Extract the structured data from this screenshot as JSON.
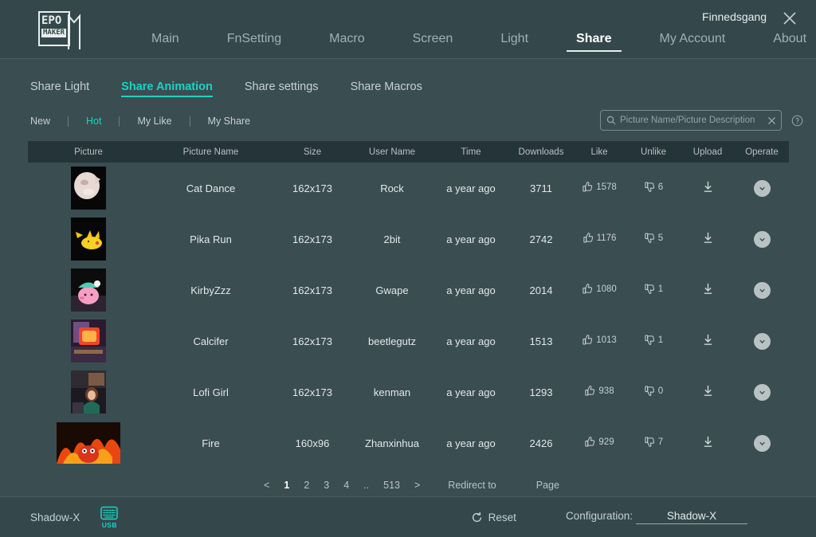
{
  "header": {
    "logo_top": "EPO",
    "logo_bottom": "MAKER",
    "username": "Finnedsgang",
    "close_icon": "close-icon",
    "nav": [
      {
        "label": "Main",
        "active": false
      },
      {
        "label": "FnSetting",
        "active": false
      },
      {
        "label": "Macro",
        "active": false
      },
      {
        "label": "Screen",
        "active": false
      },
      {
        "label": "Light",
        "active": false
      },
      {
        "label": "Share",
        "active": true
      },
      {
        "label": "My Account",
        "active": false
      },
      {
        "label": "About",
        "active": false
      }
    ]
  },
  "subnav": [
    {
      "label": "Share Light",
      "active": false
    },
    {
      "label": "Share Animation",
      "active": true
    },
    {
      "label": "Share settings",
      "active": false
    },
    {
      "label": "Share Macros",
      "active": false
    }
  ],
  "filters": [
    {
      "label": "New",
      "active": false
    },
    {
      "label": "Hot",
      "active": true
    },
    {
      "label": "My Like",
      "active": false
    },
    {
      "label": "My Share",
      "active": false
    }
  ],
  "search": {
    "placeholder": "Picture Name/Picture Description",
    "value": "",
    "search_icon": "search-icon",
    "clear_icon": "clear-icon",
    "help_icon": "help-icon"
  },
  "table": {
    "columns": [
      "Picture",
      "Picture Name",
      "Size",
      "User Name",
      "Time",
      "Downloads",
      "Like",
      "Unlike",
      "Upload",
      "Operate"
    ],
    "rows": [
      {
        "name": "Cat Dance",
        "size": "162x173",
        "user": "Rock",
        "time": "a year ago",
        "downloads": "3711",
        "likes": "1578",
        "dislikes": "6",
        "thumb": "cat-dance-thumbnail",
        "wide": false
      },
      {
        "name": "Pika Run",
        "size": "162x173",
        "user": "2bit",
        "time": "a year ago",
        "downloads": "2742",
        "likes": "1176",
        "dislikes": "5",
        "thumb": "pika-run-thumbnail",
        "wide": false
      },
      {
        "name": "KirbyZzz",
        "size": "162x173",
        "user": "Gwape",
        "time": "a year ago",
        "downloads": "2014",
        "likes": "1080",
        "dislikes": "1",
        "thumb": "kirby-zzz-thumbnail",
        "wide": false
      },
      {
        "name": "Calcifer",
        "size": "162x173",
        "user": "beetlegutz",
        "time": "a year ago",
        "downloads": "1513",
        "likes": "1013",
        "dislikes": "1",
        "thumb": "calcifer-thumbnail",
        "wide": false
      },
      {
        "name": "Lofi Girl",
        "size": "162x173",
        "user": "kenman",
        "time": "a year ago",
        "downloads": "1293",
        "likes": "938",
        "dislikes": "0",
        "thumb": "lofi-girl-thumbnail",
        "wide": false
      },
      {
        "name": "Fire",
        "size": "160x96",
        "user": "Zhanxinhua",
        "time": "a year ago",
        "downloads": "2426",
        "likes": "929",
        "dislikes": "7",
        "thumb": "fire-thumbnail",
        "wide": true
      }
    ]
  },
  "pagination": {
    "prev": "<",
    "next": ">",
    "pages": [
      "1",
      "2",
      "3",
      "4",
      "..",
      "513"
    ],
    "current": "1",
    "redirect_label": "Redirect to",
    "page_label": "Page",
    "page_input_value": ""
  },
  "footer": {
    "device": "Shadow-X",
    "connection": "USB",
    "keyboard_icon": "keyboard-icon",
    "reset_label": "Reset",
    "reset_icon": "refresh-icon",
    "configuration_label": "Configuration:",
    "configuration_value": "Shadow-X"
  },
  "colors": {
    "background": "#3a4d51",
    "bar": "#34484c",
    "table_header": "#253438",
    "accent": "#14d6c4",
    "text": "#d7dedf",
    "muted": "#9fb0b2"
  }
}
